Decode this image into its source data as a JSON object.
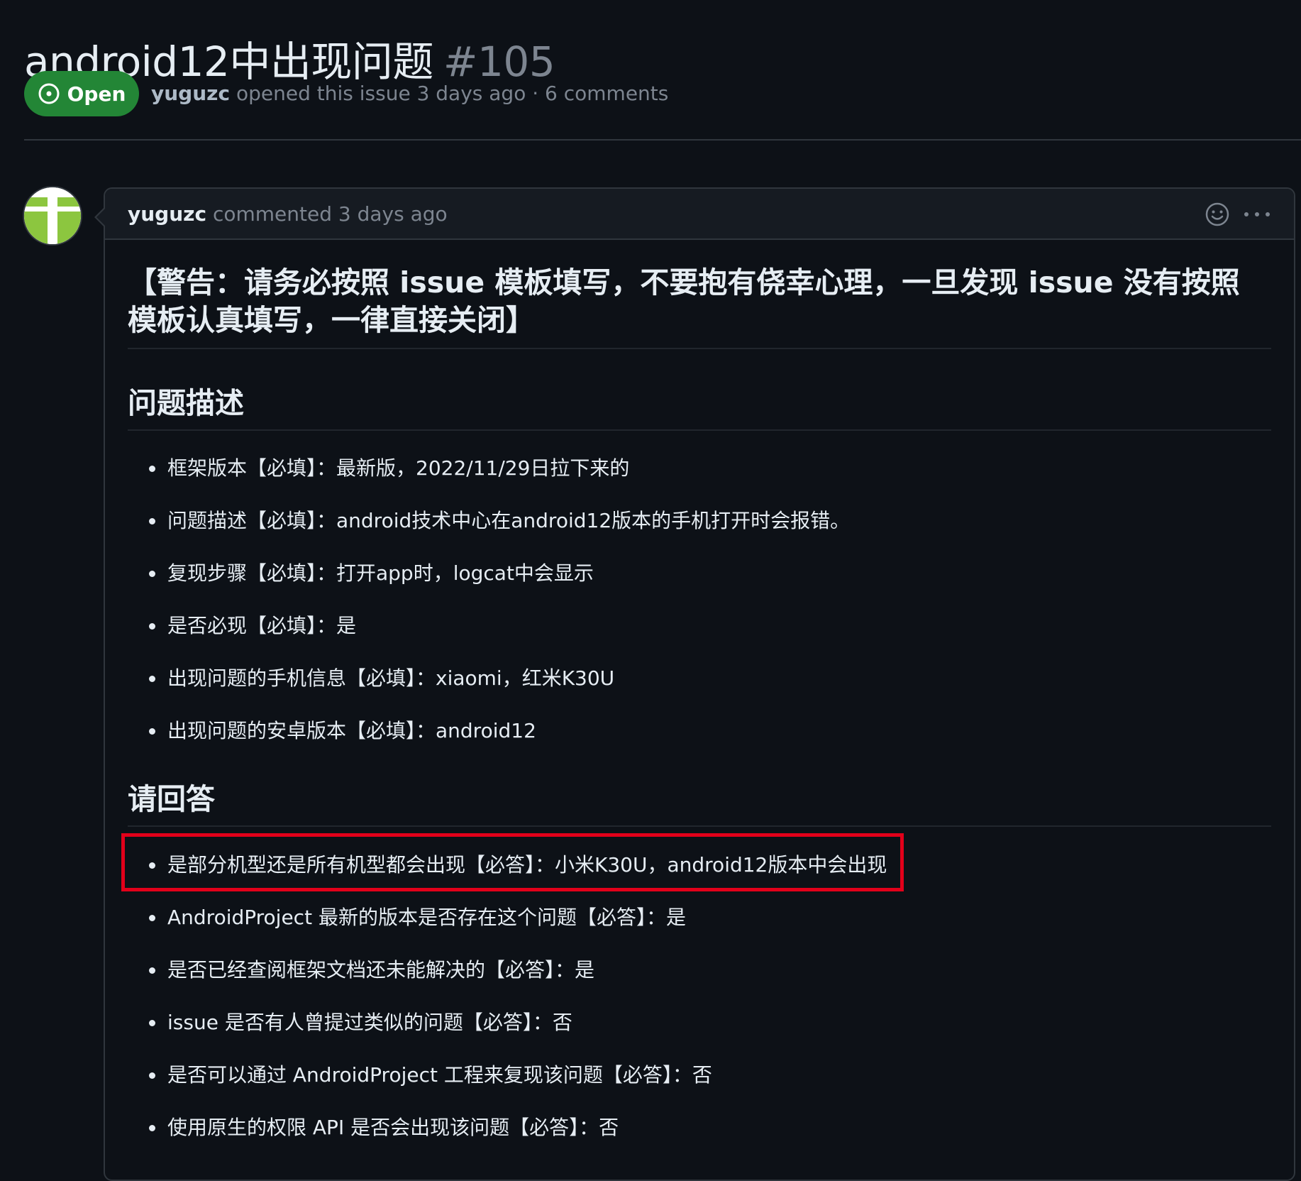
{
  "issue": {
    "title": "android12中出现问题",
    "number": "#105",
    "state": "Open",
    "author": "yuguzc",
    "meta_rest": "opened this issue 3 days ago · 6 comments"
  },
  "comment": {
    "author": "yuguzc",
    "action": "commented 3 days ago",
    "warning_heading": "【警告：请务必按照 issue 模板填写，不要抱有侥幸心理，一旦发现 issue 没有按照模板认真填写，一律直接关闭】",
    "section1_heading": "问题描述",
    "section1_items": [
      "框架版本【必填】：最新版，2022/11/29日拉下来的",
      "问题描述【必填】：android技术中心在android12版本的手机打开时会报错。",
      "复现步骤【必填】：打开app时，logcat中会显示",
      "是否必现【必填】：是",
      "出现问题的手机信息【必填】：xiaomi，红米K30U",
      "出现问题的安卓版本【必填】：android12"
    ],
    "section2_heading": "请回答",
    "section2_items": [
      "是部分机型还是所有机型都会出现【必答】：小米K30U，android12版本中会出现",
      "AndroidProject 最新的版本是否存在这个问题【必答】：是",
      "是否已经查阅框架文档还未能解决的【必答】：是",
      "issue 是否有人曾提过类似的问题【必答】：否",
      "是否可以通过 AndroidProject 工程来复现该问题【必答】：否",
      "使用原生的权限 API 是否会出现该问题【必答】：否"
    ]
  },
  "colors": {
    "open_badge": "#238636",
    "highlight": "#e2001a",
    "avatar_green": "#8cc63f"
  },
  "icons": [
    "issue-opened-icon",
    "smiley-icon",
    "kebab-horizontal-icon"
  ]
}
